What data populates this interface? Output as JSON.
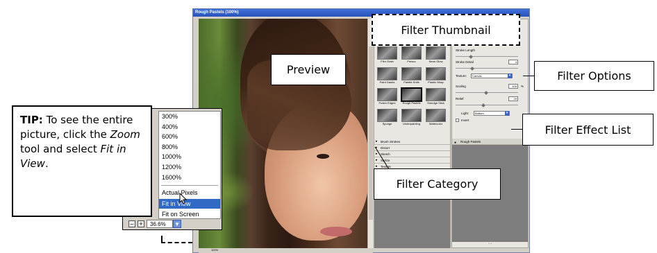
{
  "window": {
    "title": "Rough Pastels (100%)"
  },
  "preview_bottom": {
    "zoom": "100%"
  },
  "gallery": {
    "thumbnails": [
      {
        "label": "Film Grain"
      },
      {
        "label": "Fresco"
      },
      {
        "label": "Neon Glow"
      },
      {
        "label": "Paint Daubs"
      },
      {
        "label": "Palette Knife"
      },
      {
        "label": "Plastic Wrap"
      },
      {
        "label": "Poster Edges"
      },
      {
        "label": "Rough Pastels"
      },
      {
        "label": "Smudge Stick"
      },
      {
        "label": "Sponge"
      },
      {
        "label": "Underpainting"
      },
      {
        "label": "Watercolor"
      }
    ],
    "categories": [
      "Brush Strokes",
      "Distort",
      "Sketch",
      "Stylize",
      "Texture"
    ]
  },
  "options": {
    "stroke_length_label": "Stroke Length",
    "stroke_detail_label": "Stroke Detail",
    "stroke_detail_value": "4",
    "texture_label": "Texture:",
    "texture_value": "Canvas",
    "scaling_label": "Scaling",
    "scaling_value": "100",
    "scaling_unit": "%",
    "relief_label": "Relief",
    "relief_value": "20",
    "light_label": "Light:",
    "light_value": "Bottom",
    "invert_label": "Invert",
    "effect_layer": "Rough Pastels"
  },
  "zoom_menu": {
    "items": [
      "300%",
      "400%",
      "600%",
      "800%",
      "1000%",
      "1200%",
      "1600%"
    ],
    "actual_pixels": "Actual Pixels",
    "fit_in_view": "Fit in View",
    "fit_on_screen": "Fit on Screen",
    "zoom_minus": "–",
    "zoom_plus": "+",
    "zoom_value": "36.6%"
  },
  "callouts": {
    "filter_thumbnail": "Filter Thumbnail",
    "preview": "Preview",
    "filter_options": "Filter Options",
    "filter_effect_list": "Filter Effect List",
    "filter_category": "Filter Category"
  },
  "tip": {
    "bold": "TIP:",
    "part1": " To see the entire picture, click the ",
    "zoom": "Zoom",
    "part2": " tool and select ",
    "fit": "Fit in View",
    "part3": "."
  }
}
